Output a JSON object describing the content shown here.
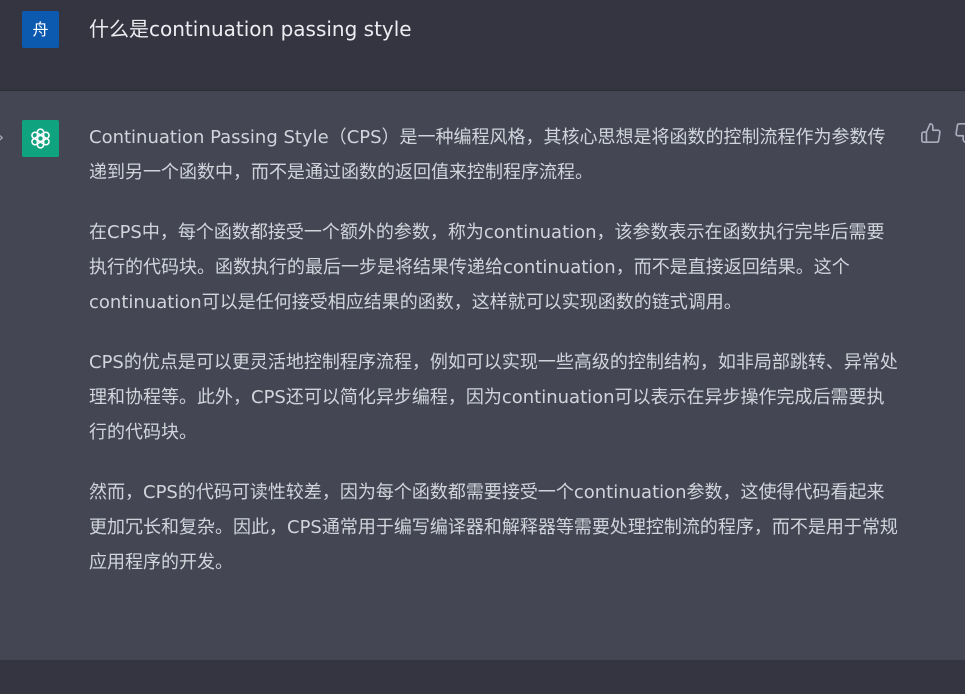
{
  "user_message": {
    "avatar_text": "舟",
    "text": "什么是continuation passing style"
  },
  "assistant_message": {
    "paragraphs": [
      "Continuation Passing Style（CPS）是一种编程风格，其核心思想是将函数的控制流程作为参数传递到另一个函数中，而不是通过函数的返回值来控制程序流程。",
      "在CPS中，每个函数都接受一个额外的参数，称为continuation，该参数表示在函数执行完毕后需要执行的代码块。函数执行的最后一步是将结果传递给continuation，而不是直接返回结果。这个continuation可以是任何接受相应结果的函数，这样就可以实现函数的链式调用。",
      "CPS的优点是可以更灵活地控制程序流程，例如可以实现一些高级的控制结构，如非局部跳转、异常处理和协程等。此外，CPS还可以简化异步编程，因为continuation可以表示在异步操作完成后需要执行的代码块。",
      "然而，CPS的代码可读性较差，因为每个函数都需要接受一个continuation参数，这使得代码看起来更加冗长和复杂。因此，CPS通常用于编写编译器和解释器等需要处理控制流的程序，而不是用于常规应用程序的开发。"
    ]
  },
  "colors": {
    "user_bg": "#343541",
    "assistant_bg": "#444654",
    "bot_avatar": "#10a37f",
    "user_avatar": "#0c5ab0"
  },
  "icons": {
    "bot_avatar": "openai-logo-icon",
    "like": "thumbs-up-icon",
    "dislike": "thumbs-down-icon",
    "chevron": "chevron-right-icon"
  }
}
